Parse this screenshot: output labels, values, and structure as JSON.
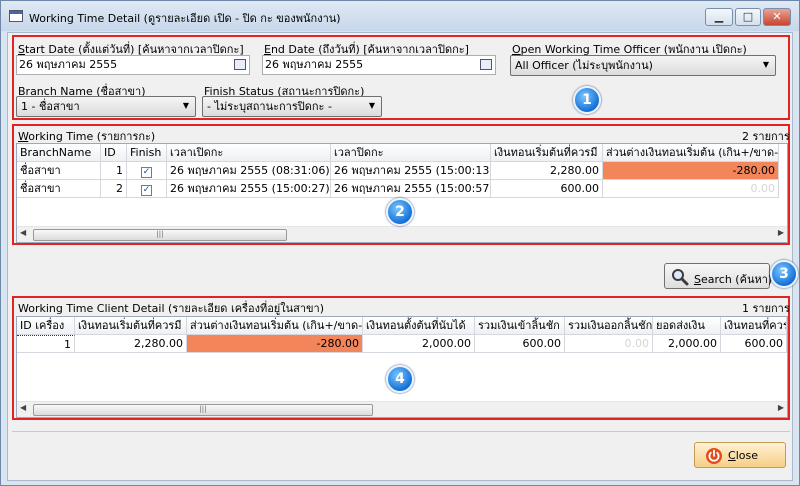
{
  "window": {
    "title": "Working Time Detail (ดูรายละเอียด เปิด - ปิด กะ ของพนักงาน)",
    "minimize_glyph": "▁",
    "maximize_glyph": "□",
    "close_glyph": "✕"
  },
  "filters": {
    "start_date_label_u": "S",
    "start_date_label": "tart Date (ตั้งแต่วันที่) [ค้นหาจากเวลาปิดกะ]",
    "start_date_value": "26 พฤษภาคม  2555",
    "end_date_label_u": "E",
    "end_date_label": "nd Date (ถึงวันที่) [ค้นหาจากเวลาปิดกะ]",
    "end_date_value": "26 พฤษภาคม  2555",
    "officer_label_u": "O",
    "officer_label": "pen Working Time Officer (พนักงาน เปิดกะ)",
    "officer_value": "All Officer (ไม่ระบุพนักงาน)",
    "branch_label_u": "B",
    "branch_label": "ranch Name (ชื่อสาขา)",
    "branch_value": "1 - ชื่อสาขา",
    "status_label_u": "F",
    "status_label": "inish Status (สถานะการปิดกะ)",
    "status_value": "- ไม่ระบุสถานะการปิดกะ -"
  },
  "working_time": {
    "title_u": "W",
    "title": "orking Time (รายการกะ)",
    "count": "2 รายการ",
    "columns": [
      "BranchName",
      "ID",
      "Finish",
      "เวลาเปิดกะ",
      "เวลาปิดกะ",
      "เงินทอนเริ่มต้นที่ควรมี",
      "ส่วนต่างเงินทอนเริ่มต้น (เกิน+/ขาด-)"
    ],
    "rows": [
      {
        "branch": "ชื่อสาขา",
        "id": "1",
        "open": "26 พฤษภาคม  2555  (08:31:06)",
        "close": "26 พฤษภาคม  2555  (15:00:13)",
        "start_change": "2,280.00",
        "diff": "-280.00"
      },
      {
        "branch": "ชื่อสาขา",
        "id": "2",
        "open": "26 พฤษภาคม  2555  (15:00:27)",
        "close": "26 พฤษภาคม  2555  (15:00:57)",
        "start_change": "600.00",
        "diff": "0.00"
      }
    ]
  },
  "search_button": {
    "label_u": "S",
    "label": "earch (ค้นหา)"
  },
  "client_detail": {
    "title": "Working Time Client Detail (รายละเอียด เครื่องที่อยู่ในสาขา)",
    "count": "1 รายการ",
    "columns": [
      "ID เครื่อง",
      "เงินทอนเริ่มต้นที่ควรมี",
      "ส่วนต่างเงินทอนเริ่มต้น (เกิน+/ขาด-)",
      "เงินทอนตั้งต้นที่นับได้",
      "รวมเงินเข้าลิ้นชัก",
      "รวมเงินออกลิ้นชัก",
      "ยอดส่งเงิน",
      "เงินทอนที่ควรเหลือ"
    ],
    "rows": [
      {
        "id": "1",
        "start_change": "2,280.00",
        "diff": "-280.00",
        "counted": "2,000.00",
        "drawer_in": "600.00",
        "drawer_out": "0.00",
        "send": "2,000.00",
        "remain": "600.00"
      }
    ]
  },
  "close_button": {
    "label_u": "C",
    "label": "lose"
  },
  "badges": [
    "1",
    "2",
    "3",
    "4"
  ],
  "colors": {
    "highlight": "#f3855a",
    "annotation_border": "#e22323",
    "badge": "#1470d8"
  }
}
